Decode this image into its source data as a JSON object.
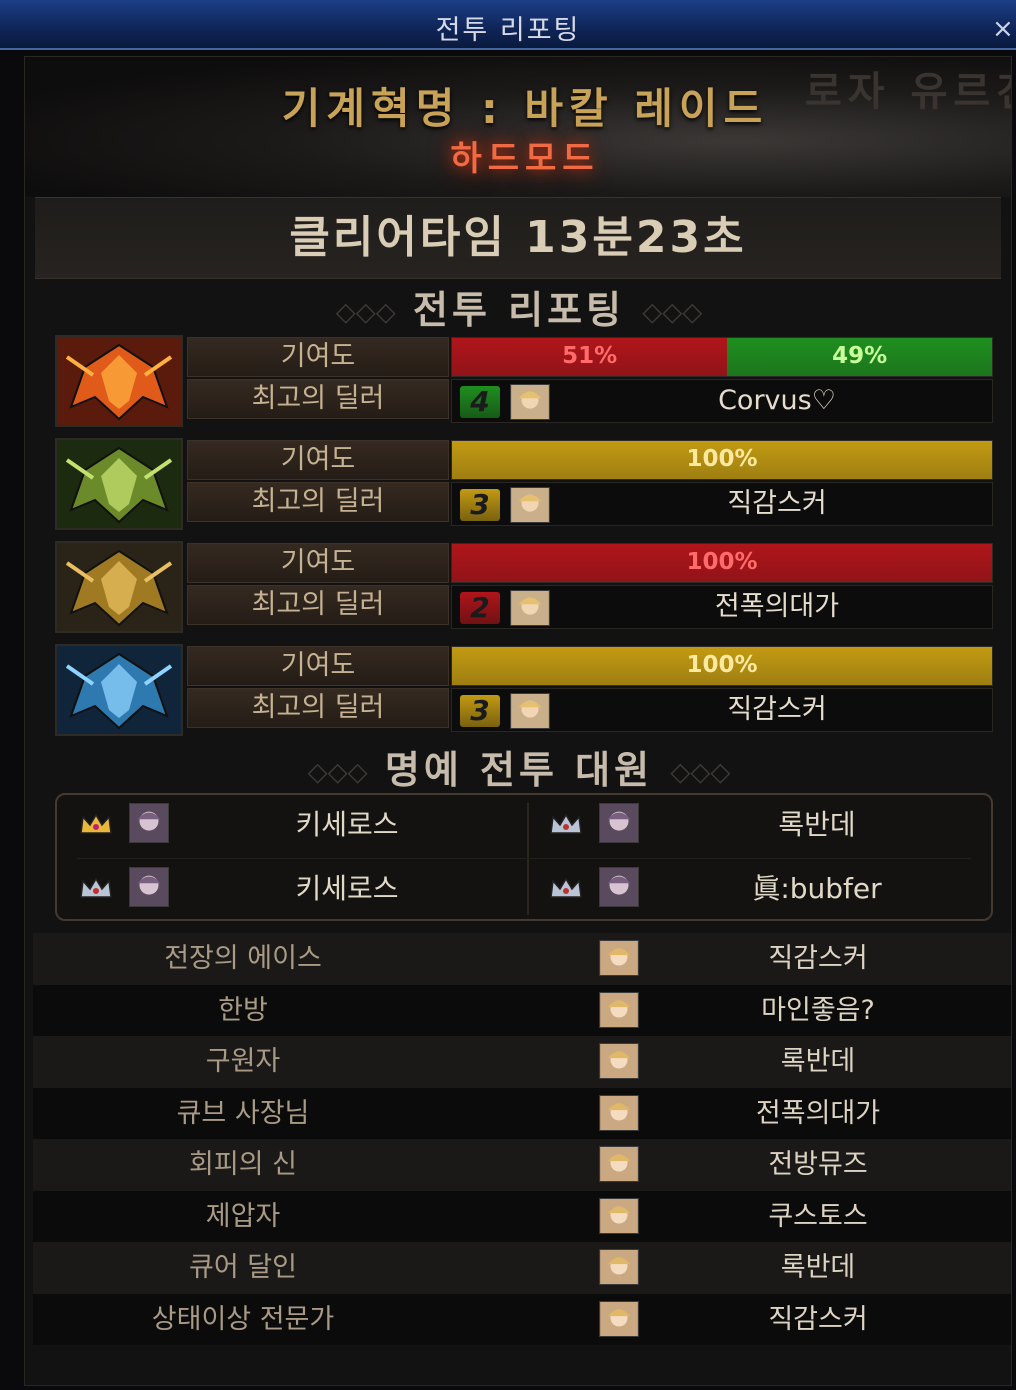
{
  "window": {
    "title": "전투 리포팅",
    "close_glyph": "×"
  },
  "header": {
    "background_name": "로자 유르겐",
    "dungeon_title": "기계혁명 : 바칼 레이드",
    "mode": "하드모드",
    "clear_time": "클리어타임 13분23초"
  },
  "sections": {
    "report_heading": "전투 리포팅",
    "team_heading": "명예 전투 대원",
    "ornament_left": "◇◇◇",
    "ornament_right": "◇◇◇"
  },
  "colors": {
    "red": "#b0151a",
    "green": "#1f8f1f",
    "gold": "#c29a12",
    "red_text": "#ff6b6b",
    "green_text": "#c8ff9a",
    "gold_text": "#ffe9a0"
  },
  "reports": [
    {
      "boss_icon": "fire-dragon-icon",
      "contribution_label": "기여도",
      "dealer_label": "최고의 딜러",
      "segments": [
        {
          "pct": 51,
          "label": "51%",
          "color": "red"
        },
        {
          "pct": 49,
          "label": "49%",
          "color": "green"
        }
      ],
      "party_number": "4",
      "party_color": "green",
      "dealer_name": "Corvus♡"
    },
    {
      "boss_icon": "green-dragon-icon",
      "contribution_label": "기여도",
      "dealer_label": "최고의 딜러",
      "segments": [
        {
          "pct": 100,
          "label": "100%",
          "color": "gold"
        }
      ],
      "party_number": "3",
      "party_color": "gold",
      "dealer_name": "직감스커"
    },
    {
      "boss_icon": "gold-dragon-icon",
      "contribution_label": "기여도",
      "dealer_label": "최고의 딜러",
      "segments": [
        {
          "pct": 100,
          "label": "100%",
          "color": "red"
        }
      ],
      "party_number": "2",
      "party_color": "red",
      "dealer_name": "전폭의대가"
    },
    {
      "boss_icon": "ice-dragon-icon",
      "contribution_label": "기여도",
      "dealer_label": "최고의 딜러",
      "segments": [
        {
          "pct": 100,
          "label": "100%",
          "color": "gold"
        }
      ],
      "party_number": "3",
      "party_color": "gold",
      "dealer_name": "직감스커"
    }
  ],
  "honor_members": [
    {
      "name": "키세로스",
      "medal": "gold-crown-icon"
    },
    {
      "name": "록반데",
      "medal": "silver-crown-icon"
    },
    {
      "name": "키세로스",
      "medal": "silver-crown-icon"
    },
    {
      "name": "眞:bubfer",
      "medal": "silver-crown-icon"
    }
  ],
  "awards": [
    {
      "title": "전장의 에이스",
      "name": "직감스커"
    },
    {
      "title": "한방",
      "name": "마인좋음?"
    },
    {
      "title": "구원자",
      "name": "록반데"
    },
    {
      "title": "큐브 사장님",
      "name": "전폭의대가"
    },
    {
      "title": "회피의 신",
      "name": "전방뮤즈"
    },
    {
      "title": "제압자",
      "name": "쿠스토스"
    },
    {
      "title": "큐어 달인",
      "name": "록반데"
    },
    {
      "title": "상태이상 전문가",
      "name": "직감스커"
    }
  ]
}
